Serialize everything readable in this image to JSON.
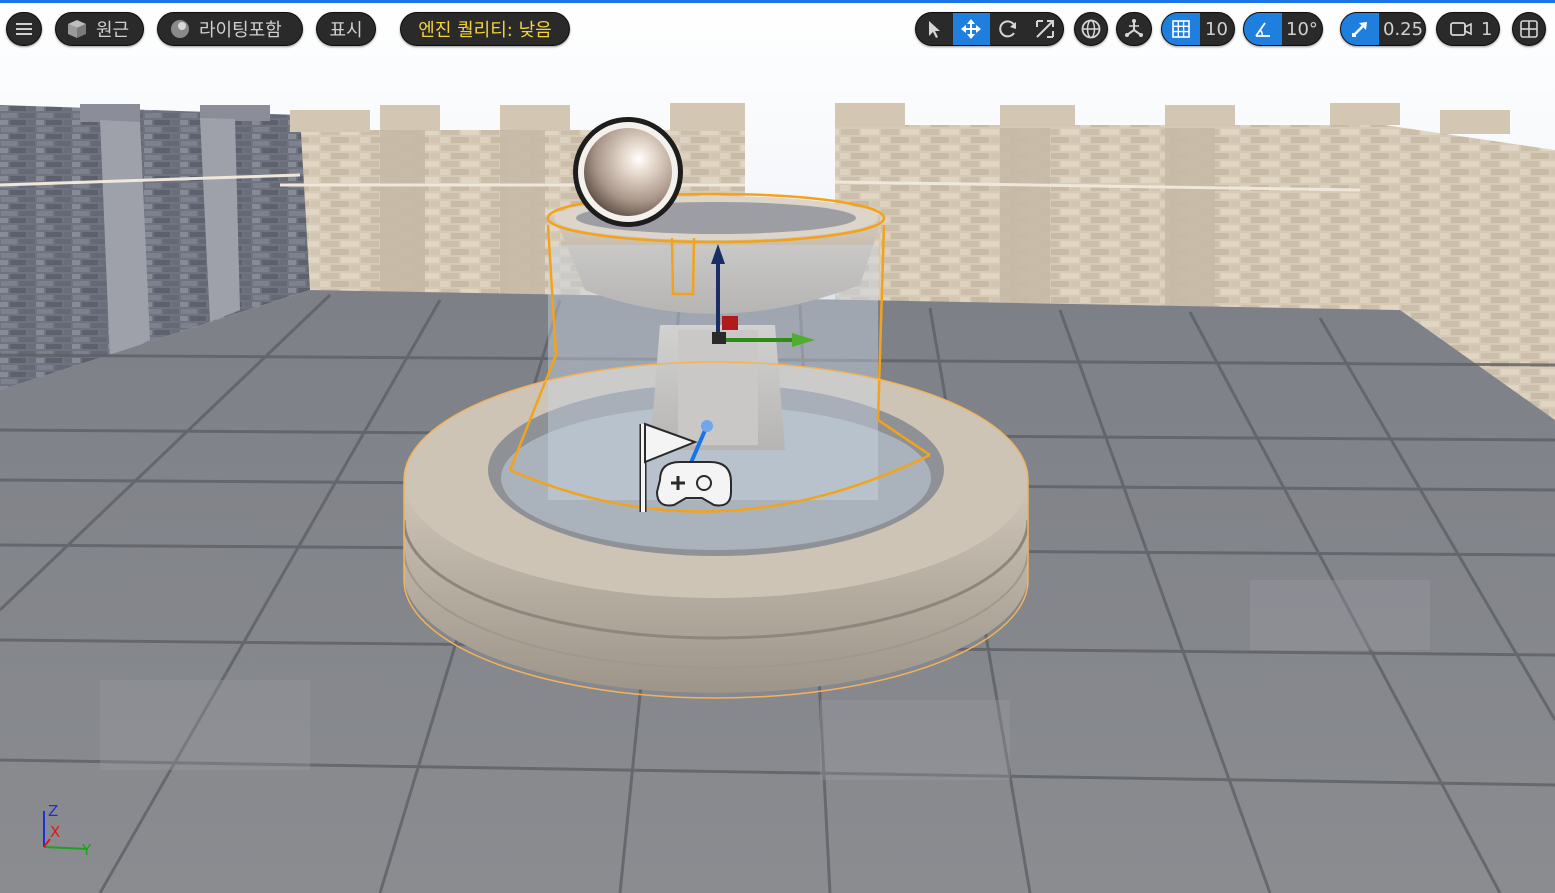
{
  "toolbar": {
    "menu_icon": "hamburger-icon",
    "perspective": {
      "icon": "cube-icon",
      "label": "원근"
    },
    "lighting": {
      "icon": "sphere-icon",
      "label": "라이팅포함"
    },
    "show": {
      "label": "표시"
    },
    "quality": {
      "label": "엔진 퀄리티: 낮음",
      "color": "#f3d23a"
    },
    "transform_tools": [
      "select-arrow-icon",
      "move-icon",
      "rotate-icon",
      "scale-icon"
    ],
    "active_tool": "move-icon",
    "world_local_icon": "globe-icon",
    "surface_snap_icon": "surface-snap-icon",
    "grid_snap": {
      "icon": "grid-icon",
      "value": "10"
    },
    "rotation_snap": {
      "icon": "angle-icon",
      "value": "10°"
    },
    "scale_snap": {
      "icon": "scale-arrow-icon",
      "value": "0.25"
    },
    "camera_speed": {
      "icon": "camera-icon",
      "value": "1"
    },
    "layout_icon": "viewport-layout-icon",
    "accent_color": "#1f7fde"
  },
  "axis_indicator": {
    "z": "Z",
    "x": "X",
    "y": "Y"
  }
}
